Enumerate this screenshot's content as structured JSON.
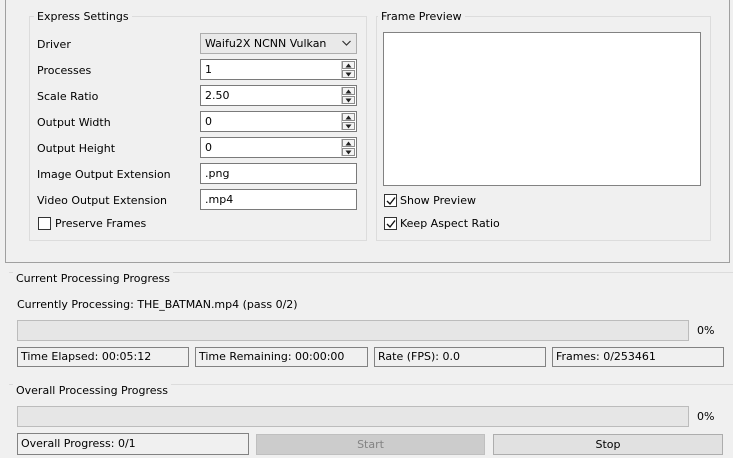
{
  "express_settings": {
    "title": "Express Settings",
    "driver_label": "Driver",
    "driver_value": "Waifu2X NCNN Vulkan",
    "processes_label": "Processes",
    "processes_value": "1",
    "scale_ratio_label": "Scale Ratio",
    "scale_ratio_value": "2.50",
    "output_width_label": "Output Width",
    "output_width_value": "0",
    "output_height_label": "Output Height",
    "output_height_value": "0",
    "image_ext_label": "Image Output Extension",
    "image_ext_value": ".png",
    "video_ext_label": "Video Output Extension",
    "video_ext_value": ".mp4",
    "preserve_frames_label": "Preserve Frames",
    "preserve_frames_checked": false
  },
  "frame_preview": {
    "title": "Frame Preview",
    "show_preview_label": "Show Preview",
    "show_preview_checked": true,
    "keep_aspect_label": "Keep Aspect Ratio",
    "keep_aspect_checked": true
  },
  "current_progress": {
    "title": "Current Processing Progress",
    "currently_processing": "Currently Processing: THE_BATMAN.mp4 (pass 0/2)",
    "percent_text": "0%",
    "progress_fraction": 0,
    "time_elapsed": "Time Elapsed: 00:05:12",
    "time_remaining": "Time Remaining: 00:00:00",
    "rate": "Rate (FPS): 0.0",
    "frames": "Frames: 0/253461"
  },
  "overall_progress": {
    "title": "Overall Processing Progress",
    "percent_text": "0%",
    "progress_fraction": 0,
    "overall_text": "Overall Progress: 0/1",
    "start_label": "Start",
    "stop_label": "Stop"
  },
  "colors": {
    "window_bg": "#f0f0f0",
    "disabled_text": "#838383"
  },
  "icons": {
    "combo_arrow": "chevron-down-icon",
    "spin_up": "caret-up-icon",
    "spin_down": "caret-down-icon",
    "check": "checkmark-icon"
  }
}
